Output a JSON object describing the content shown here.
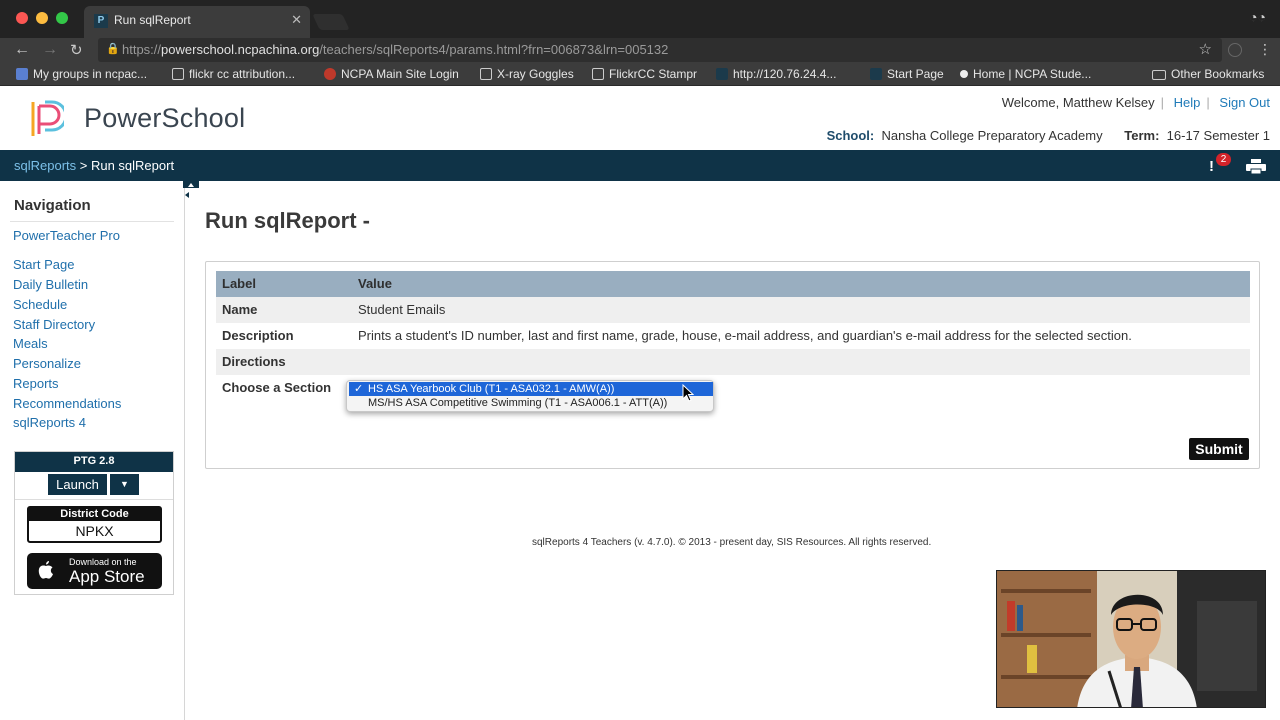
{
  "browser": {
    "tab_title": "Run sqlReport",
    "url_prefix": "https://",
    "url_host": "powerschool.ncpachina.org",
    "url_path": "/teachers/sqlReports4/params.html?frn=006873&lrn=005132",
    "bookmarks": [
      "My groups in ncpac...",
      "flickr cc attribution...",
      "NCPA Main Site Login",
      "X-ray Goggles",
      "FlickrCC Stampr",
      "http://120.76.24.4...",
      "Start Page",
      "Home | NCPA Stude..."
    ],
    "other_bookmarks": "Other Bookmarks"
  },
  "header": {
    "logo_text": "PowerSchool",
    "welcome": "Welcome, Matthew Kelsey",
    "help": "Help",
    "sign_out": "Sign Out",
    "school_label": "School:",
    "school_value": "Nansha College Preparatory Academy",
    "term_label": "Term:",
    "term_value": "16-17 Semester 1"
  },
  "breadcrumb": {
    "parent": "sqlReports",
    "separator": " > ",
    "current": "Run sqlReport",
    "alert_count": "2"
  },
  "sidebar": {
    "title": "Navigation",
    "top_link": "PowerTeacher Pro",
    "links": [
      "Start Page",
      "Daily Bulletin",
      "Schedule",
      "Staff Directory",
      "Meals",
      "Personalize",
      "Reports",
      "Recommendations",
      "sqlReports 4"
    ],
    "ptg": {
      "header": "PTG 2.8",
      "launch": "Launch",
      "district_code_label": "District Code",
      "district_code": "NPKX",
      "appstore_small": "Download on the",
      "appstore_big": "App Store"
    }
  },
  "main": {
    "title": "Run sqlReport -",
    "table": {
      "headers": [
        "Label",
        "Value"
      ],
      "rows": [
        {
          "label": "Name",
          "value": "Student Emails"
        },
        {
          "label": "Description",
          "value": "Prints a student's ID number, last and first name, grade, house, e-mail address, and guardian's e-mail address for the selected section."
        },
        {
          "label": "Directions",
          "value": ""
        },
        {
          "label": "Choose a Section",
          "value": ""
        }
      ]
    },
    "section_options": [
      "HS ASA Yearbook Club (T1 - ASA032.1 - AMW(A))",
      "MS/HS ASA Competitive Swimming (T1 - ASA006.1 - ATT(A))"
    ],
    "selected_option_check": "✓",
    "submit": "Submit"
  },
  "footer": "sqlReports 4 Teachers (v. 4.7.0). © 2013 - present day, SIS Resources. All rights reserved.",
  "colors": {
    "nav_bar": "#0f3347",
    "table_header": "#99aec0",
    "link": "#1f6fab",
    "selection": "#1e66d8"
  }
}
